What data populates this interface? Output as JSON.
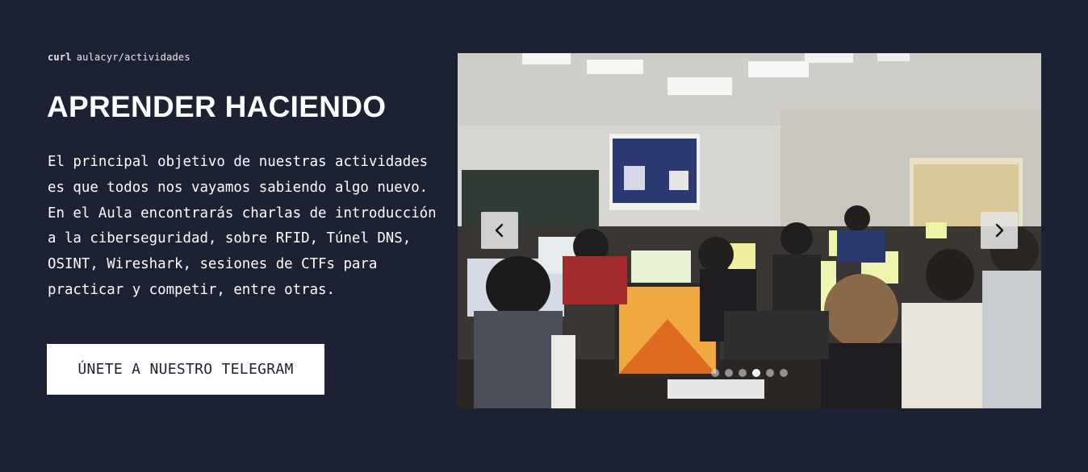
{
  "header": {
    "command": "curl",
    "path": "aulacyr/actividades"
  },
  "title": "APRENDER HACIENDO",
  "description": "El principal objetivo de nuestras actividades es que todos nos vayamos sabiendo algo nuevo. En el Aula encontrarás charlas de introducción a la ciberseguridad, sobre RFID, Túnel DNS, OSINT, Wireshark, sesiones de CTFs para practicar y competir, entre otras.",
  "cta": {
    "label": "ÚNETE A NUESTRO TELEGRAM"
  },
  "carousel": {
    "prev_icon": "chevron-left-icon",
    "next_icon": "chevron-right-icon",
    "slide_count": 6,
    "active_index": 3
  },
  "colors": {
    "background": "#1c2233",
    "text": "#ffffff",
    "button_bg": "#ffffff",
    "button_text": "#1c2233"
  }
}
